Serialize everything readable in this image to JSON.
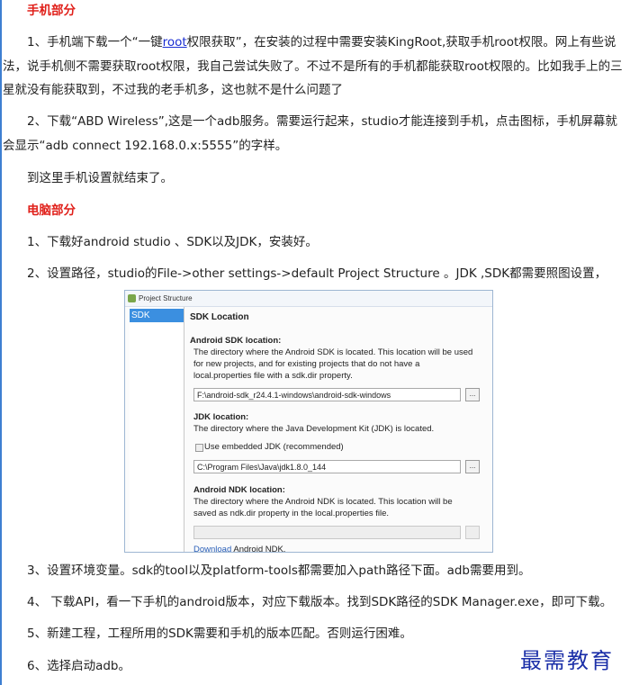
{
  "sections": {
    "phone_heading": "手机部分",
    "pc_heading": "电脑部分"
  },
  "phone": {
    "p1_before_link": "1、手机端下载一个“一键",
    "p1_link": "root",
    "p1_after_link": "权限获取”，在安装的过程中需要安装KingRoot,获取手机root权限。网上有些说法，说手机侧不需要获取root权限，我自己尝试失败了。不过不是所有的手机都能获取root权限的。比如我手上的三星就没有能获取到，不过我的老手机多，这也就不是什么问题了",
    "p2": "2、下载“ABD Wireless”,这是一个adb服务。需要运行起来，studio才能连接到手机，点击图标，手机屏幕就会显示“adb connect 192.168.0.x:5555”的字样。",
    "p3": "到这里手机设置就结束了。"
  },
  "pc": {
    "s1": "1、下载好android studio 、SDK以及JDK，安装好。",
    "s2": "2、设置路径，studio的File->other settings->default Project Structure 。JDK ,SDK都需要照图设置，",
    "s3": "3、设置环境变量。sdk的tool以及platform-tools都需要加入path路径下面。adb需要用到。",
    "s4": "4、 下载API，看一下手机的android版本，对应下载版本。找到SDK路径的SDK Manager.exe，即可下载。",
    "s5": "5、新建工程，工程所用的SDK需要和手机的版本匹配。否则运行困难。",
    "s6": "6、选择启动adb。"
  },
  "screenshot": {
    "window_title": "Project Structure",
    "sidebar_item": "SDK Locati...",
    "panel_title": "SDK Location",
    "android_sdk_heading": "Android SDK location:",
    "android_sdk_desc_1": "The directory where the Android SDK is located. This location will be used",
    "android_sdk_desc_2": "for new projects, and for existing projects that do not have a",
    "android_sdk_desc_3": "local.properties file with a sdk.dir property.",
    "android_sdk_path": "F:\\android-sdk_r24.4.1-windows\\android-sdk-windows",
    "jdk_heading": "JDK location:",
    "jdk_desc": "The directory where the Java Development Kit (JDK) is located.",
    "jdk_checkbox": "Use embedded JDK (recommended)",
    "jdk_path": "C:\\Program Files\\Java\\jdk1.8.0_144",
    "ndk_heading": "Android NDK location:",
    "ndk_desc_1": "The directory where the Android NDK is located. This location will be",
    "ndk_desc_2": "saved as ndk.dir property in the local.properties file.",
    "ndk_path": "",
    "ndk_download_link": "Download",
    "ndk_download_rest": " Android NDK.",
    "browse_label": "..."
  },
  "watermark": "最需教育",
  "colors": {
    "heading": "#e0201a",
    "link": "#1a2ed2",
    "watermark": "#1b2fa8",
    "selection": "#3b8fe0"
  }
}
